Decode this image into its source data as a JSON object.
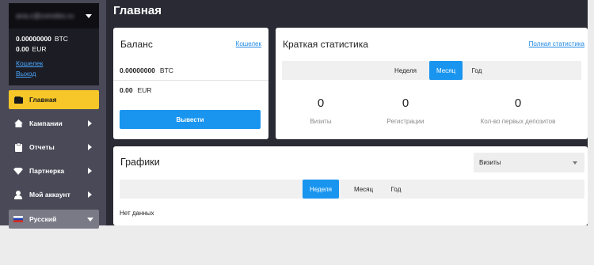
{
  "account": {
    "email": "ana.c@comdes.ru",
    "btc_amount": "0.00000000",
    "btc_currency": "BTC",
    "eur_amount": "0.00",
    "eur_currency": "EUR",
    "wallet_link": "Кошелек",
    "logout_link": "Выход"
  },
  "nav": {
    "main": "Главная",
    "campaigns": "Кампании",
    "reports": "Отчеты",
    "partner": "Партнерка",
    "my_account": "Мой аккаунт",
    "language": "Русский"
  },
  "page": {
    "title": "Главная"
  },
  "balance": {
    "title": "Баланс",
    "wallet_link": "Кошелек",
    "btc_amount": "0.00000000",
    "btc_currency": "BTC",
    "eur_amount": "0.00",
    "eur_currency": "EUR",
    "withdraw_button": "Вывести"
  },
  "stats": {
    "title": "Краткая статистика",
    "full_link": "Полная статистика",
    "tabs": [
      "Неделя",
      "Месяц",
      "Год"
    ],
    "active_tab": "Месяц",
    "items": [
      {
        "value": "0",
        "label": "Визиты"
      },
      {
        "value": "0",
        "label": "Регистрации"
      },
      {
        "value": "0",
        "label": "Кол-во первых депозитов"
      }
    ]
  },
  "charts": {
    "title": "Графики",
    "select_value": "Визиты",
    "tabs": [
      "Неделя",
      "Месяц",
      "Год"
    ],
    "active_tab": "Неделя",
    "no_data": "Нет данных"
  },
  "colors": {
    "accent": "#1995ef",
    "active_nav": "#f7c729",
    "sidebar": "#4a4958",
    "app_bg": "#2a2a35"
  }
}
